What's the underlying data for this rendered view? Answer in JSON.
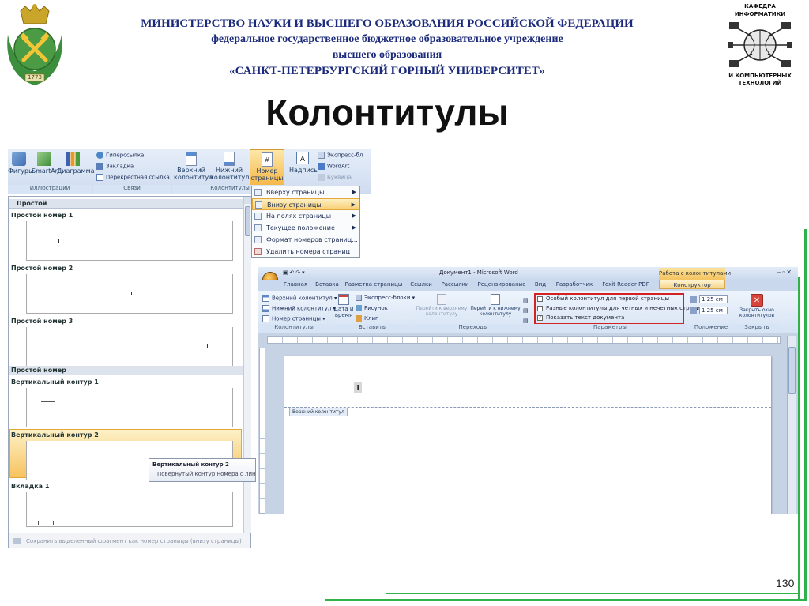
{
  "header": {
    "ministry": "МИНИСТЕРСТВО НАУКИ И ВЫСШЕГО ОБРАЗОВАНИЯ РОССИЙСКОЙ ФЕДЕРАЦИИ",
    "institution_line1": "федеральное государственное бюджетное образовательное учреждение",
    "institution_line2": "высшего образования",
    "university": "«САНКТ-ПЕТЕРБУРГСКИЙ ГОРНЫЙ УНИВЕРСИТЕТ»",
    "dept_top_1": "КАФЕДРА",
    "dept_top_2": "ИНФОРМАТИКИ",
    "dept_bottom_1": "И КОМПЬЮТЕРНЫХ",
    "dept_bottom_2": "ТЕХНОЛОГИЙ",
    "logo_year": "1773"
  },
  "slide_title": "Колонтитулы",
  "page_number": "130",
  "ribbon1": {
    "buttons": {
      "shapes": "Фигуры",
      "smartart": "SmartArt",
      "diagram": "Диаграмма",
      "hyperlink": "Гиперссылка",
      "bookmark": "Закладка",
      "crossref": "Перекрестная ссылка",
      "header_l1": "Верхний",
      "header_l2": "колонтитул",
      "footer_l1": "Нижний",
      "footer_l2": "колонтитул",
      "pagenum_l1": "Номер",
      "pagenum_l2": "страницы",
      "textbox": "Надпись",
      "express": "Экспресс-бл",
      "wordart": "WordArt",
      "dropcap": "Буквица"
    },
    "groups": {
      "illustrations": "Иллюстрации",
      "links": "Связи",
      "headerfooter": "Колонтитулы"
    }
  },
  "page_menu": {
    "items": [
      {
        "label": "Вверху страницы",
        "arrow": "▶"
      },
      {
        "label": "Внизу страницы",
        "arrow": "▶"
      },
      {
        "label": "На полях страницы",
        "arrow": "▶"
      },
      {
        "label": "Текущее положение",
        "arrow": "▶"
      },
      {
        "label": "Формат номеров страниц...",
        "arrow": ""
      },
      {
        "label": "Удалить номера страниц",
        "arrow": ""
      }
    ]
  },
  "gallery": {
    "section1": "Простой",
    "items1": [
      "Простой номер 1",
      "Простой номер 2",
      "Простой номер 3"
    ],
    "section2": "Простой номер",
    "items2": [
      "Вертикальный контур 1",
      "Вертикальный контур 2",
      "Вкладка 1"
    ],
    "footer": "Сохранить выделенный фрагмент как номер страницы (внизу страницы)",
    "tooltip_title": "Вертикальный контур 2",
    "tooltip_desc": "Повернутый контур номера с линией"
  },
  "word2": {
    "window_title": "Документ1 - Microsoft Word",
    "context_tab_group": "Работа с колонтитулами",
    "tabs": [
      "Главная",
      "Вставка",
      "Разметка страницы",
      "Ссылки",
      "Рассылки",
      "Рецензирование",
      "Вид",
      "Разработчик",
      "Foxit Reader PDF",
      "Конструктор"
    ],
    "ribbon": {
      "header_btn": "Верхний колонтитул",
      "footer_btn": "Нижний колонтитул",
      "pagenum_btn": "Номер страницы",
      "date_l1": "Дата и",
      "date_l2": "время",
      "express": "Экспресс-блоки",
      "picture": "Рисунок",
      "clip": "Клип",
      "goto_header_l1": "Перейти к верхнему",
      "goto_header_l2": "колонтитулу",
      "goto_footer_l1": "Перейти к нижнему",
      "goto_footer_l2": "колонтитулу",
      "opt1": "Особый колонтитул для первой страницы",
      "opt2": "Разные колонтитулы для четных и нечетных страниц",
      "opt3": "Показать текст документа",
      "pos1": "1,25 см",
      "pos2": "1,25 см",
      "close_l1": "Закрыть окно",
      "close_l2": "колонтитулов"
    },
    "groups": {
      "headerfooter": "Колонтитулы",
      "insert": "Вставить",
      "transitions": "Переходы",
      "params": "Параметры",
      "position": "Положение",
      "close": "Закрыть"
    },
    "page_number_digit": "1",
    "header_label": "Верхний колонтитул"
  },
  "colors": {
    "title_blue": "#1b2a7a",
    "green_frame": "#2fb24a",
    "ribbon_bg": "#dbe7f6",
    "highlight_orange": "#f7c35f",
    "red_box": "#d22222"
  }
}
